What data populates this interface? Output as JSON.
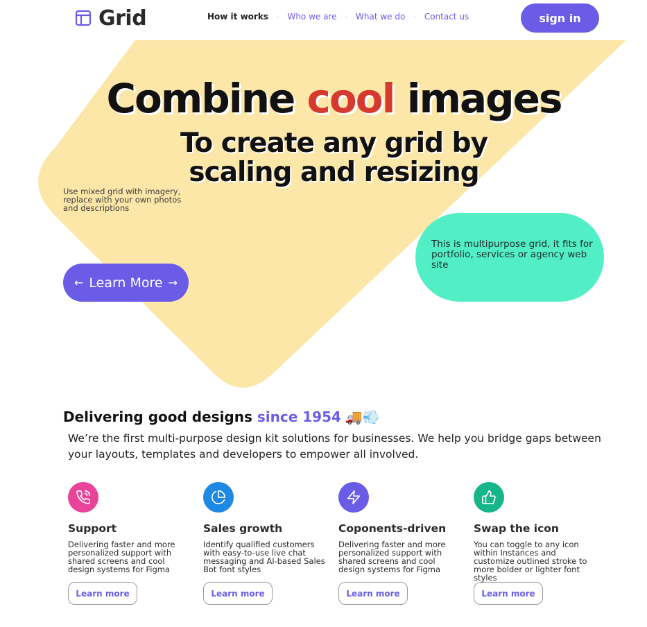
{
  "header": {
    "logo_text": "Grid",
    "logo_icon": "layout-icon",
    "nav": [
      {
        "label": "How it works",
        "active": true
      },
      {
        "label": "Who we are",
        "active": false
      },
      {
        "label": "What we do",
        "active": false
      },
      {
        "label": "Contact us",
        "active": false
      }
    ],
    "nav_separator": "·",
    "signin_label": "sign in"
  },
  "hero": {
    "title_before": "Combine ",
    "title_accent": "cool",
    "title_after": " images",
    "subtitle_line1": "To create any grid by",
    "subtitle_line2": "scaling and resizing",
    "note": "Use mixed grid with imagery, replace with your own photos and descriptions",
    "learn_more_label": "Learn More",
    "pill_text": "This is multipurpose grid, it fits for portfolio, services or agency web site",
    "colors": {
      "shape": "#fde7a8",
      "accent": "#d63a2f",
      "button": "#6b5ce7",
      "pill": "#52efc6"
    }
  },
  "delivering": {
    "title_before": "Delivering good designs ",
    "title_accent": "since 1954",
    "emoji": "🚚💨",
    "description": "We’re the first multi-purpose design kit solutions for businesses. We help you bridge gaps between your layouts, templates and developers to empower all involved."
  },
  "features": [
    {
      "icon": "phone-icon",
      "color": "#e8449a",
      "title": "Support",
      "desc": "Delivering faster and more personalized support with shared screens and cool design systems for Figma",
      "button": "Learn more"
    },
    {
      "icon": "pie-chart-icon",
      "color": "#1e88e5",
      "title": "Sales growth",
      "desc": "Identify qualified customers with easy-to-use live chat messaging and AI-based Sales Bot font styles",
      "button": "Learn more"
    },
    {
      "icon": "lightning-icon",
      "color": "#6b5ce7",
      "title": "Coponents-driven",
      "desc": "Delivering faster and more personalized support with shared screens and cool design systems for Figma",
      "button": "Learn more"
    },
    {
      "icon": "thumbs-up-icon",
      "color": "#16b68a",
      "title": "Swap the icon",
      "desc": "You can toggle to any icon within Instances and customize outlined stroke to more bolder or lighter font styles",
      "button": "Learn more"
    }
  ]
}
